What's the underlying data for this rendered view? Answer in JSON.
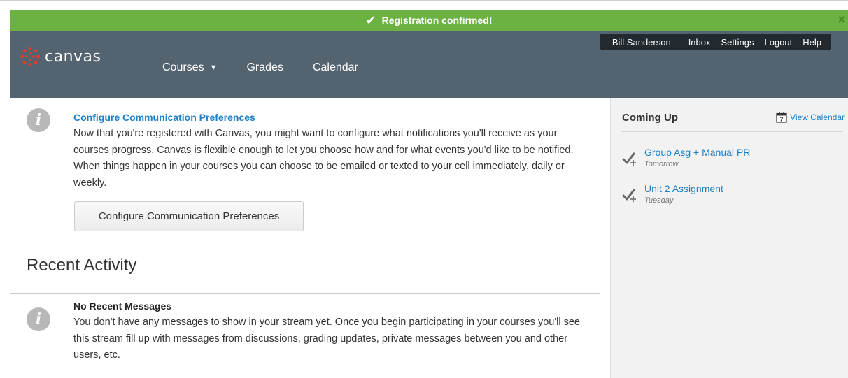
{
  "banner": {
    "message": "Registration confirmed!",
    "check_icon": "checkmark-icon",
    "close_icon": "close-icon",
    "close_glyph": "×",
    "check_glyph": "✔"
  },
  "header": {
    "logo_text": "canvas",
    "nav": [
      {
        "label": "Courses",
        "has_caret": true
      },
      {
        "label": "Grades"
      },
      {
        "label": "Calendar"
      }
    ],
    "caret_glyph": "▼",
    "user_links": [
      "Bill Sanderson",
      "Inbox",
      "Settings",
      "Logout",
      "Help"
    ]
  },
  "notice": {
    "title": "Configure Communication Preferences",
    "body": "Now that you're registered with Canvas, you might want to configure what notifications you'll receive as your courses progress. Canvas is flexible enough to let you choose how and for what events you'd like to be notified. When things happen in your courses you can choose to be emailed or texted to your cell immediately, daily or weekly.",
    "button_label": "Configure Communication Preferences",
    "icon_glyph": "i"
  },
  "recent": {
    "title": "Recent Activity",
    "empty_title": "No Recent Messages",
    "empty_body": "You don't have any messages to show in your stream yet. Once you begin participating in your courses you'll see this stream fill up with messages from discussions, grading updates, private messages between you and other users, etc.",
    "icon_glyph": "i"
  },
  "sidebar": {
    "title": "Coming Up",
    "view_calendar": "View Calendar",
    "calendar_day": "7",
    "items": [
      {
        "name": "Group Asg + Manual PR",
        "date": "Tomorrow"
      },
      {
        "name": "Unit 2 Assignment",
        "date": "Tuesday"
      }
    ]
  },
  "colors": {
    "banner_green": "#6bb242",
    "header_slate": "#536470",
    "link_blue": "#1b7fc8",
    "logo_red": "#e03e2d"
  }
}
